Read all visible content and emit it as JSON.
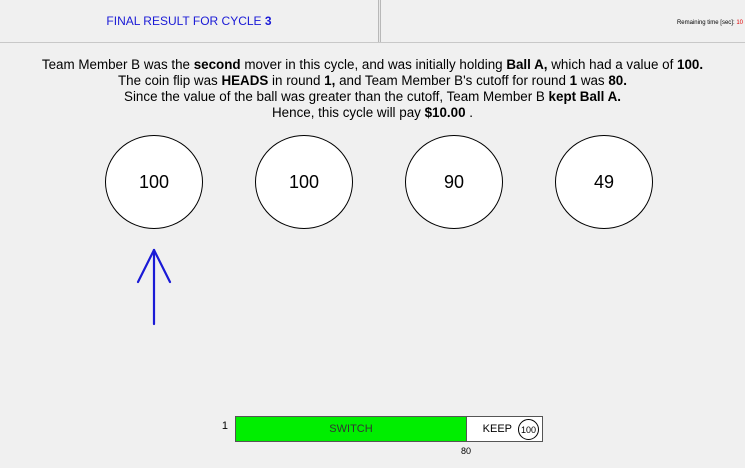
{
  "header": {
    "title_prefix": "FINAL RESULT FOR CYCLE ",
    "cycle_number": "3",
    "remaining_label": "Remaining time [sec]:",
    "remaining_value": "10"
  },
  "message": {
    "line1": [
      {
        "t": "Team Member B was the ",
        "b": false
      },
      {
        "t": "second",
        "b": true
      },
      {
        "t": " mover in this cycle, and was initially holding ",
        "b": false
      },
      {
        "t": "Ball A,",
        "b": true
      },
      {
        "t": " which had a value of ",
        "b": false
      },
      {
        "t": "100.",
        "b": true
      }
    ],
    "line2": [
      {
        "t": "The coin flip was ",
        "b": false
      },
      {
        "t": "HEADS",
        "b": true
      },
      {
        "t": " in round ",
        "b": false
      },
      {
        "t": "1,",
        "b": true
      },
      {
        "t": " and Team Member B's cutoff for round ",
        "b": false
      },
      {
        "t": "1",
        "b": true
      },
      {
        "t": " was ",
        "b": false
      },
      {
        "t": "80.",
        "b": true
      }
    ],
    "line3": [
      {
        "t": "Since the value of the ball was greater than the cutoff, Team Member B ",
        "b": false
      },
      {
        "t": "kept Ball A.",
        "b": true
      }
    ],
    "line4": [
      {
        "t": "Hence, this cycle will pay ",
        "b": false
      },
      {
        "t": "$10.00",
        "b": true
      },
      {
        "t": " .",
        "b": false
      }
    ]
  },
  "balls": [
    {
      "value": "100"
    },
    {
      "value": "100"
    },
    {
      "value": "90"
    },
    {
      "value": "49"
    }
  ],
  "arrow_icon": "up-arrow-icon",
  "arrow_color": "#1a1ad6",
  "cutoff_bar": {
    "round": "1",
    "switch_label": "SWITCH",
    "keep_label": "KEEP",
    "keep_value": "100",
    "cutoff_value": "80",
    "switch_fraction": 0.75,
    "switch_color": "#00ee00"
  }
}
